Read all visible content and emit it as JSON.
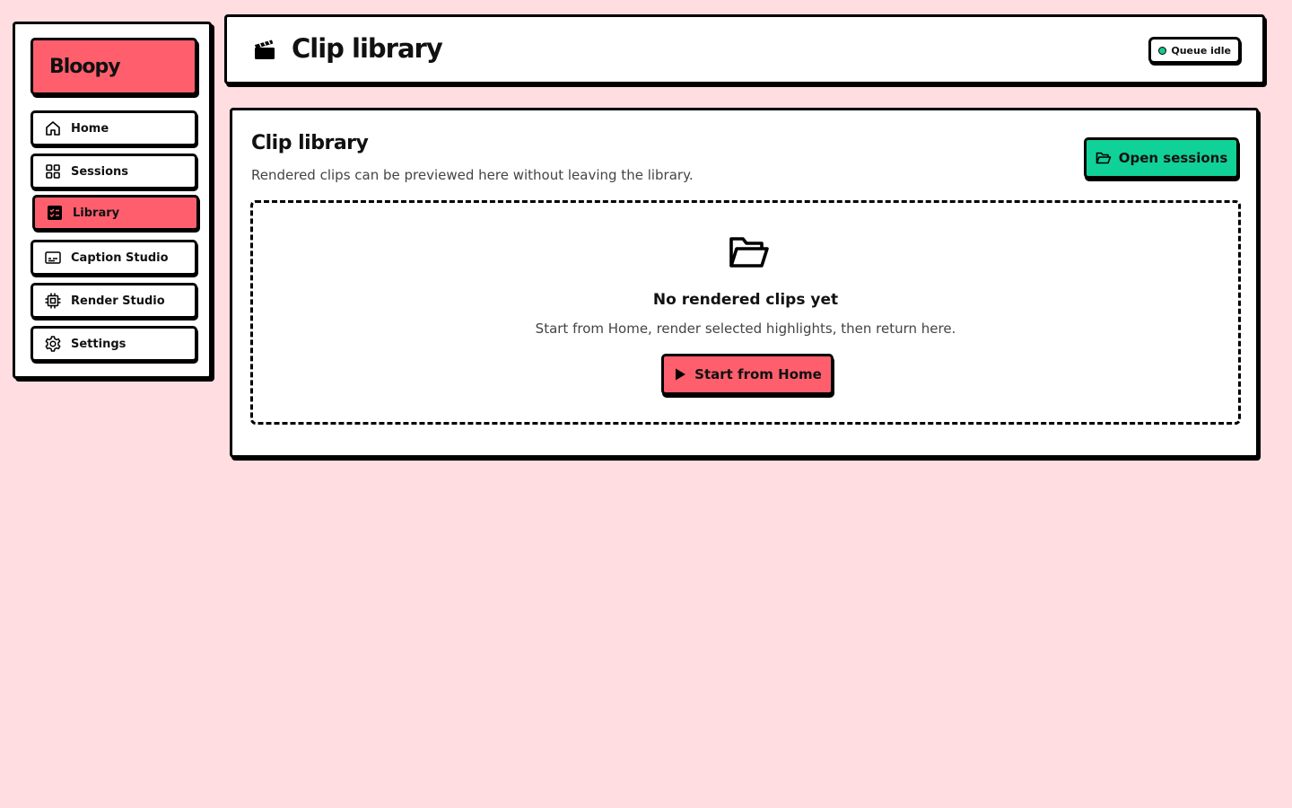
{
  "sidebar": {
    "brand": "Bloopy",
    "items": [
      {
        "label": "Home",
        "icon": "home-icon"
      },
      {
        "label": "Sessions",
        "icon": "grid-icon"
      },
      {
        "label": "Library",
        "icon": "checklist-icon",
        "active": true
      },
      {
        "label": "Caption Studio",
        "icon": "captions-icon"
      },
      {
        "label": "Render Studio",
        "icon": "chip-icon"
      },
      {
        "label": "Settings",
        "icon": "gear-icon"
      }
    ]
  },
  "header": {
    "title": "Clip library",
    "icon": "clapperboard-icon",
    "status": "Queue idle"
  },
  "main": {
    "title": "Clip library",
    "subtitle": "Rendered clips can be previewed here without leaving the library.",
    "open_sessions_label": "Open sessions",
    "empty_state": {
      "icon": "folder-open-icon",
      "title": "No rendered clips yet",
      "description": "Start from Home, render selected highlights, then return here.",
      "cta_label": "Start from Home"
    }
  },
  "colors": {
    "background": "#ffdde1",
    "accent": "#ff5f6d",
    "success": "#10d197"
  }
}
